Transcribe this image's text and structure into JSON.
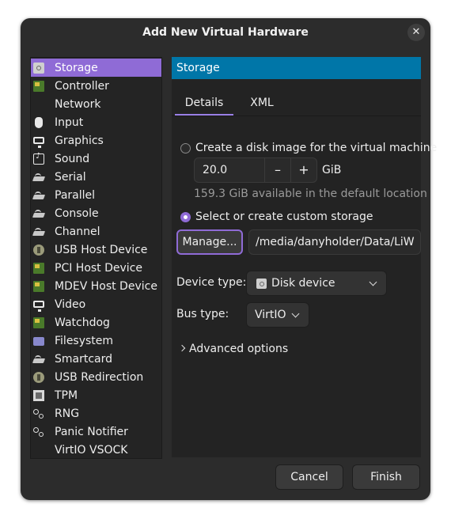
{
  "window": {
    "title": "Add New Virtual Hardware",
    "close_glyph": "✕"
  },
  "hardware_list": [
    {
      "label": "Storage",
      "icon": "disk-icon",
      "selected": true
    },
    {
      "label": "Controller",
      "icon": "card-icon"
    },
    {
      "label": "Network",
      "icon": "network-icon"
    },
    {
      "label": "Input",
      "icon": "mouse-icon"
    },
    {
      "label": "Graphics",
      "icon": "monitor-icon"
    },
    {
      "label": "Sound",
      "icon": "sound-icon"
    },
    {
      "label": "Serial",
      "icon": "plug-icon"
    },
    {
      "label": "Parallel",
      "icon": "plug-icon"
    },
    {
      "label": "Console",
      "icon": "plug-icon"
    },
    {
      "label": "Channel",
      "icon": "plug-icon"
    },
    {
      "label": "USB Host Device",
      "icon": "usb-icon"
    },
    {
      "label": "PCI Host Device",
      "icon": "card-icon"
    },
    {
      "label": "MDEV Host Device",
      "icon": "card-icon"
    },
    {
      "label": "Video",
      "icon": "monitor-icon"
    },
    {
      "label": "Watchdog",
      "icon": "card-icon"
    },
    {
      "label": "Filesystem",
      "icon": "folder-icon"
    },
    {
      "label": "Smartcard",
      "icon": "plug-icon"
    },
    {
      "label": "USB Redirection",
      "icon": "usb-icon"
    },
    {
      "label": "TPM",
      "icon": "chip-icon"
    },
    {
      "label": "RNG",
      "icon": "gears-icon"
    },
    {
      "label": "Panic Notifier",
      "icon": "gears-icon"
    },
    {
      "label": "VirtIO VSOCK",
      "icon": "network-icon"
    }
  ],
  "panel": {
    "header": "Storage",
    "tabs": [
      "Details",
      "XML"
    ],
    "create_disk_label": "Create a disk image for the virtual machine",
    "size_value": "20.0",
    "minus": "–",
    "plus": "+",
    "size_unit": "GiB",
    "available_text": "159.3 GiB available in the default location",
    "custom_storage_label": "Select or create custom storage",
    "manage_button": "Manage...",
    "storage_path": "/media/danyholder/Data/LiW",
    "device_type_label": "Device type:",
    "device_type_value": "Disk device",
    "bus_type_label": "Bus type:",
    "bus_type_value": "VirtIO",
    "advanced_label": "Advanced options"
  },
  "footer": {
    "cancel": "Cancel",
    "finish": "Finish"
  },
  "colors": {
    "accent": "#8f6bd6",
    "header_blue": "#0076a8",
    "background": "#2c2c2c"
  }
}
